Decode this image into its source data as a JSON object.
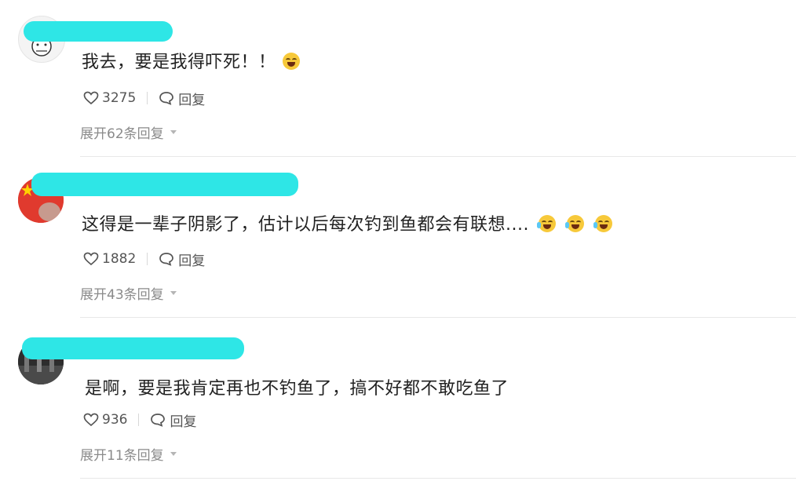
{
  "comments": [
    {
      "text": "我去，要是我得吓死！！",
      "likes": "3275",
      "reply_label": "回复",
      "expand_label": "展开62条回复",
      "emoji_count": 1
    },
    {
      "text": " 这得是一辈子阴影了，估计以后每次钓到鱼都会有联想....",
      "likes": "1882",
      "reply_label": "回复",
      "expand_label": "展开43条回复",
      "emoji_count": 3
    },
    {
      "text": "是啊，要是我肯定再也不钓鱼了，搞不好都不敢吃鱼了",
      "likes": "936",
      "reply_label": "回复",
      "expand_label": "展开11条回复",
      "emoji_count": 0
    }
  ],
  "icons": {
    "like": "heart-outline-icon",
    "reply": "speech-bubble-icon",
    "emoji": "laughing-crying-emoji-icon",
    "expand": "caret-down-icon"
  },
  "colors": {
    "name_mask": "#2ee6e6",
    "text": "#222222",
    "muted": "#8a8a8a"
  }
}
